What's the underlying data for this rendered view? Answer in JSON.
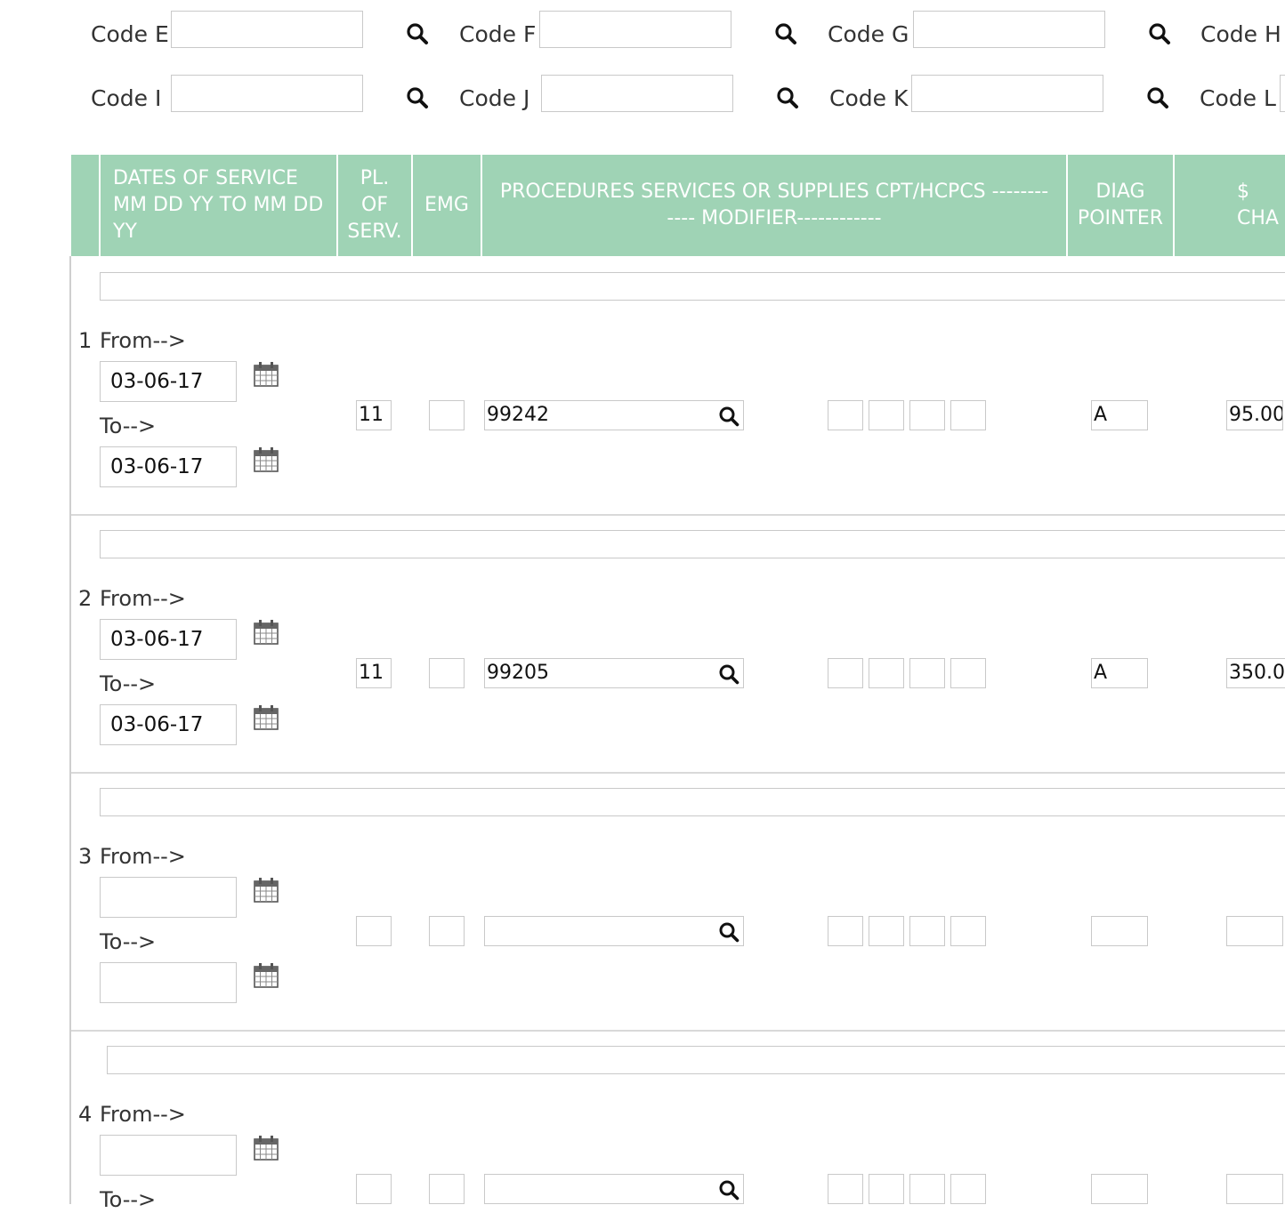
{
  "codes": [
    {
      "label": "Code E",
      "value": ""
    },
    {
      "label": "Code F",
      "value": ""
    },
    {
      "label": "Code G",
      "value": ""
    },
    {
      "label": "Code H",
      "value": ""
    },
    {
      "label": "Code I",
      "value": ""
    },
    {
      "label": "Code J",
      "value": ""
    },
    {
      "label": "Code K",
      "value": ""
    },
    {
      "label": "Code L",
      "value": ""
    }
  ],
  "table": {
    "headers": {
      "dates": "DATES OF SERVICE MM DD YY TO MM DD YY",
      "place": "PL. OF SERV.",
      "emg": "EMG",
      "procedures": "PROCEDURES SERVICES OR SUPPLIES CPT/HCPCS ------------ MODIFIER------------",
      "diag": "DIAG POINTER",
      "charges": "$ CHA"
    },
    "from_label": "From-->",
    "to_label": "To-->",
    "rows": [
      {
        "num": "1",
        "from": "03-06-17",
        "to": "03-06-17",
        "place": "11",
        "emg": "",
        "procedure": "99242",
        "diag": "A",
        "charge": "95.00"
      },
      {
        "num": "2",
        "from": "03-06-17",
        "to": "03-06-17",
        "place": "11",
        "emg": "",
        "procedure": "99205",
        "diag": "A",
        "charge": "350.0"
      },
      {
        "num": "3",
        "from": "",
        "to": "",
        "place": "",
        "emg": "",
        "procedure": "",
        "diag": "",
        "charge": ""
      },
      {
        "num": "4",
        "from": "",
        "to": "",
        "place": "",
        "emg": "",
        "procedure": "",
        "diag": "",
        "charge": ""
      }
    ]
  },
  "colors": {
    "header_bg": "#9fd3b5",
    "header_text": "#ffffff",
    "border": "#c9c9c9"
  }
}
